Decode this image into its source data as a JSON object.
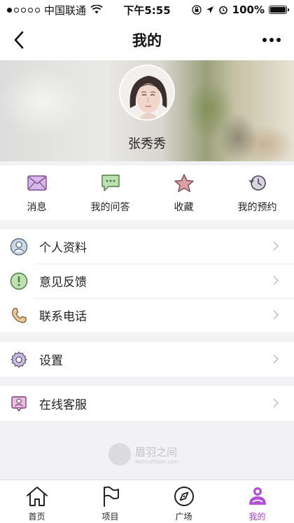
{
  "status_bar": {
    "carrier": "中国联通",
    "time": "下午5:55",
    "battery": "100%"
  },
  "nav": {
    "title": "我的"
  },
  "profile": {
    "name": "张秀秀"
  },
  "quick_actions": [
    {
      "label": "消息",
      "icon": "mail-icon"
    },
    {
      "label": "我的问答",
      "icon": "chat-bubble-icon"
    },
    {
      "label": "收藏",
      "icon": "star-icon"
    },
    {
      "label": "我的预约",
      "icon": "history-clock-icon"
    }
  ],
  "menu_group_1": [
    {
      "label": "个人资料",
      "icon": "user-profile-icon"
    },
    {
      "label": "意见反馈",
      "icon": "exclamation-icon"
    },
    {
      "label": "联系电话",
      "icon": "phone-icon"
    }
  ],
  "menu_group_2": [
    {
      "label": "设置",
      "icon": "gear-icon"
    }
  ],
  "menu_group_3": [
    {
      "label": "在线客服",
      "icon": "customer-service-icon"
    }
  ],
  "watermark": {
    "text": "眉羽之间",
    "sub": "MeiYuZhiJian.com"
  },
  "tabs": [
    {
      "label": "首页",
      "icon": "home-icon"
    },
    {
      "label": "项目",
      "icon": "flag-icon"
    },
    {
      "label": "广场",
      "icon": "compass-icon"
    },
    {
      "label": "我的",
      "icon": "profile-icon",
      "active": true
    }
  ],
  "colors": {
    "accent": "#a23cc8",
    "background": "#f2f1f4"
  }
}
